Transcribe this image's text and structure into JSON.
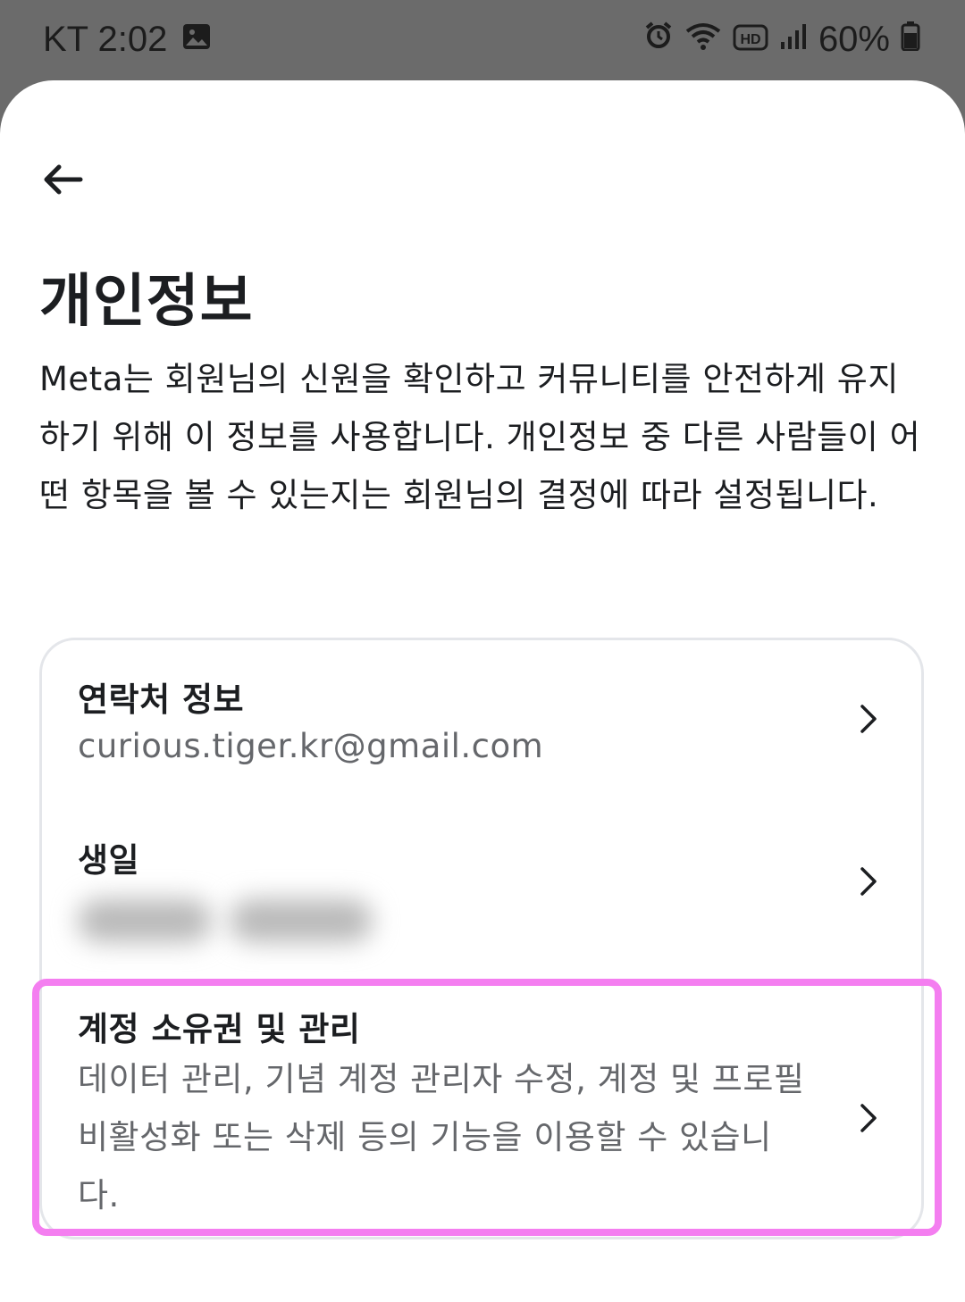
{
  "status_bar": {
    "carrier_time": "KT 2:02",
    "battery": "60%",
    "icons": [
      "gallery-icon",
      "alarm-icon",
      "wifi-icon",
      "hd-icon",
      "signal-icon",
      "battery-icon"
    ]
  },
  "header": {
    "back_icon": "arrow-left-icon",
    "title": "개인정보"
  },
  "intro": "Meta는 회원님의 신원을 확인하고 커뮤니티를 안전하게 유지하기 위해 이 정보를 사용합니다. 개인정보 중 다른 사람들이 어떤 항목을 볼 수 있는지는 회원님의 결정에 따라 설정됩니다.",
  "items": [
    {
      "title": "연락처 정보",
      "subtitle": "curious.tiger.kr@gmail.com"
    },
    {
      "title": "생일",
      "subtitle_redacted": true
    },
    {
      "title": "계정 소유권 및 관리",
      "subtitle": "데이터 관리, 기념 계정 관리자 수정, 계정 및 프로필 비활성화 또는 삭제 등의 기능을 이용할 수 있습니다.",
      "highlighted": true
    }
  ],
  "colors": {
    "highlight": "#f47ef0",
    "primary_text": "#1c1e21",
    "secondary_text": "#65676b",
    "card_border": "#e4e6ea"
  }
}
